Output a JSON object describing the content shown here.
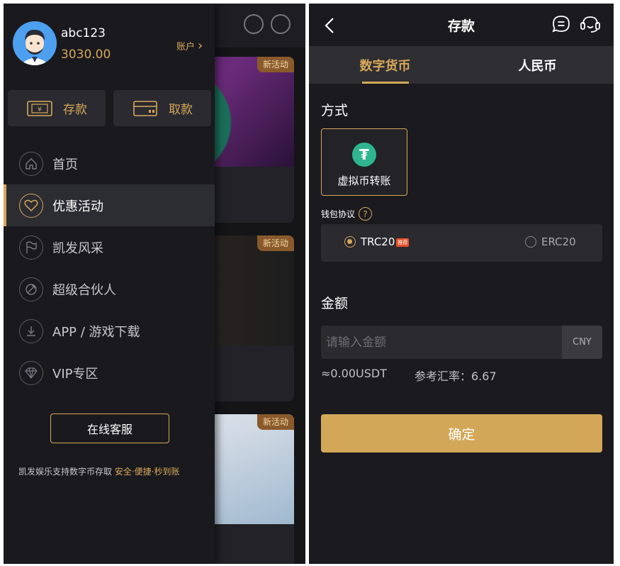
{
  "drawer": {
    "username": "abc123",
    "balance": "3030.00",
    "account_link": "账户",
    "deposit_btn": "存款",
    "withdraw_btn": "取款",
    "menu": [
      {
        "label": "首页",
        "icon": "home-icon",
        "active": false
      },
      {
        "label": "优惠活动",
        "icon": "heart-icon",
        "active": true
      },
      {
        "label": "凯发风采",
        "icon": "flag-icon",
        "active": false
      },
      {
        "label": "超级合伙人",
        "icon": "partner-icon",
        "active": false
      },
      {
        "label": "APP / 游戏下载",
        "icon": "download-icon",
        "active": false
      },
      {
        "label": "VIP专区",
        "icon": "diamond-icon",
        "active": false
      }
    ],
    "service_btn": "在线客服",
    "footer_prefix": "凯发娱乐支持数字币存取 ",
    "footer_highlight": "安全·便捷·秒到账"
  },
  "background": {
    "badges": [
      "新活动",
      "新活动",
      "新活动"
    ]
  },
  "deposit": {
    "title": "存款",
    "tabs": [
      {
        "label": "数字货币",
        "active": true
      },
      {
        "label": "人民币",
        "active": false
      }
    ],
    "method_label": "方式",
    "method_card": "虚拟币转账",
    "protocol_label": "钱包协议",
    "protocols": [
      {
        "label": "TRC20",
        "selected": true,
        "badge": "推荐"
      },
      {
        "label": "ERC20",
        "selected": false
      }
    ],
    "amount_label": "金额",
    "amount_placeholder": "请输入金额",
    "currency": "CNY",
    "converted": "≈0.00USDT",
    "rate_text": "参考汇率：6.67",
    "confirm_btn": "确定"
  },
  "colors": {
    "accent": "#d7a85a",
    "confirm": "#d2a858",
    "usdt_green": "#2fb58f"
  }
}
